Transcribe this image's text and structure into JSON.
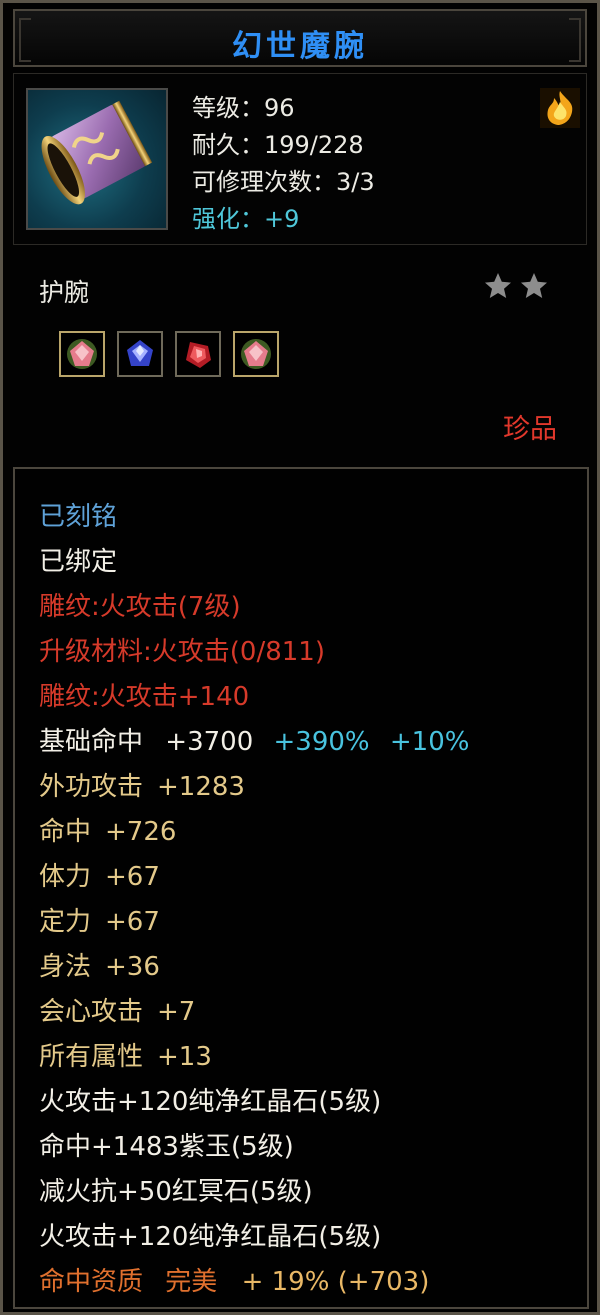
{
  "item": {
    "name": "幻世魔腕",
    "level_label": "等级：96",
    "durability_label": "耐久：199/228",
    "repair_label": "可修理次数：3/3",
    "enhance_label": "强化：+9",
    "type": "护腕",
    "stars": 2,
    "rarity": "珍品",
    "icon": "wrist-guard-icon",
    "sockets": [
      {
        "name": "pink-gem-icon",
        "color": "#d66b7a"
      },
      {
        "name": "blue-gem-icon",
        "color": "#3b4fd8"
      },
      {
        "name": "red-gem-icon",
        "color": "#c21f2a"
      },
      {
        "name": "pink-gem-icon",
        "color": "#d66b7a"
      }
    ]
  },
  "properties": {
    "engraved": "已刻铭",
    "bound": "已绑定",
    "carve_line": "雕纹:火攻击(7级)",
    "upgrade_material": "升级材料:火攻击(0/811)",
    "carve_bonus": "雕纹:火攻击+140",
    "base_hit": {
      "label": "基础命中",
      "value": "+3700",
      "pct1": "+390%",
      "pct2": "+10%"
    },
    "stats": [
      {
        "label": "外功攻击",
        "value": "+1283"
      },
      {
        "label": "命中",
        "value": "+726"
      },
      {
        "label": "体力",
        "value": "+67"
      },
      {
        "label": "定力",
        "value": "+67"
      },
      {
        "label": "身法",
        "value": "+36"
      },
      {
        "label": "会心攻击",
        "value": "+7"
      },
      {
        "label": "所有属性",
        "value": "+13"
      }
    ],
    "gems": [
      "火攻击+120纯净红晶石(5级)",
      "命中+1483紫玉(5级)",
      "减火抗+50红冥石(5级)",
      "火攻击+120纯净红晶石(5级)"
    ],
    "quality": {
      "label": "命中资质",
      "grade": "完美",
      "value": "+ 19% (+703)"
    }
  },
  "colors": {
    "title": "#2f8ff5",
    "engraved": "#5fa2d8",
    "carve": "#d63a2a",
    "stat": "#e3c98a",
    "rarity": "#e2382c",
    "enhance": "#4fc7d9"
  }
}
